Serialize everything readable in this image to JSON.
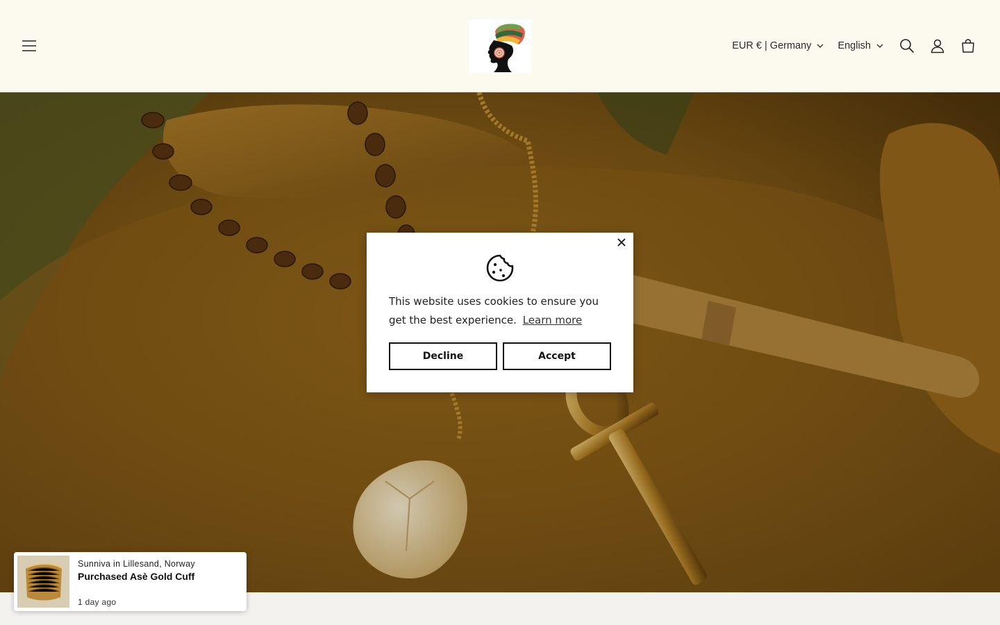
{
  "header": {
    "menu_icon": "hamburger-menu-icon",
    "logo_icon": "woman-headwrap-logo",
    "currency": "EUR € | Germany",
    "language": "English",
    "icons": [
      "search-icon",
      "account-icon",
      "cart-icon"
    ]
  },
  "cookie_banner": {
    "icon": "cookie-icon",
    "close_icon": "close-icon",
    "message": "This website uses cookies to ensure you get the best experience.",
    "learn_more": "Learn more",
    "decline_label": "Decline",
    "accept_label": "Accept"
  },
  "purchase_popup": {
    "location": "Sunniva in Lillesand, Norway",
    "title": "Purchased Asè Gold Cuff",
    "time": "1 day ago"
  },
  "colors": {
    "header_bg": "#fcf9ee",
    "hero_tone": "#8a5e18",
    "text": "#121212"
  }
}
